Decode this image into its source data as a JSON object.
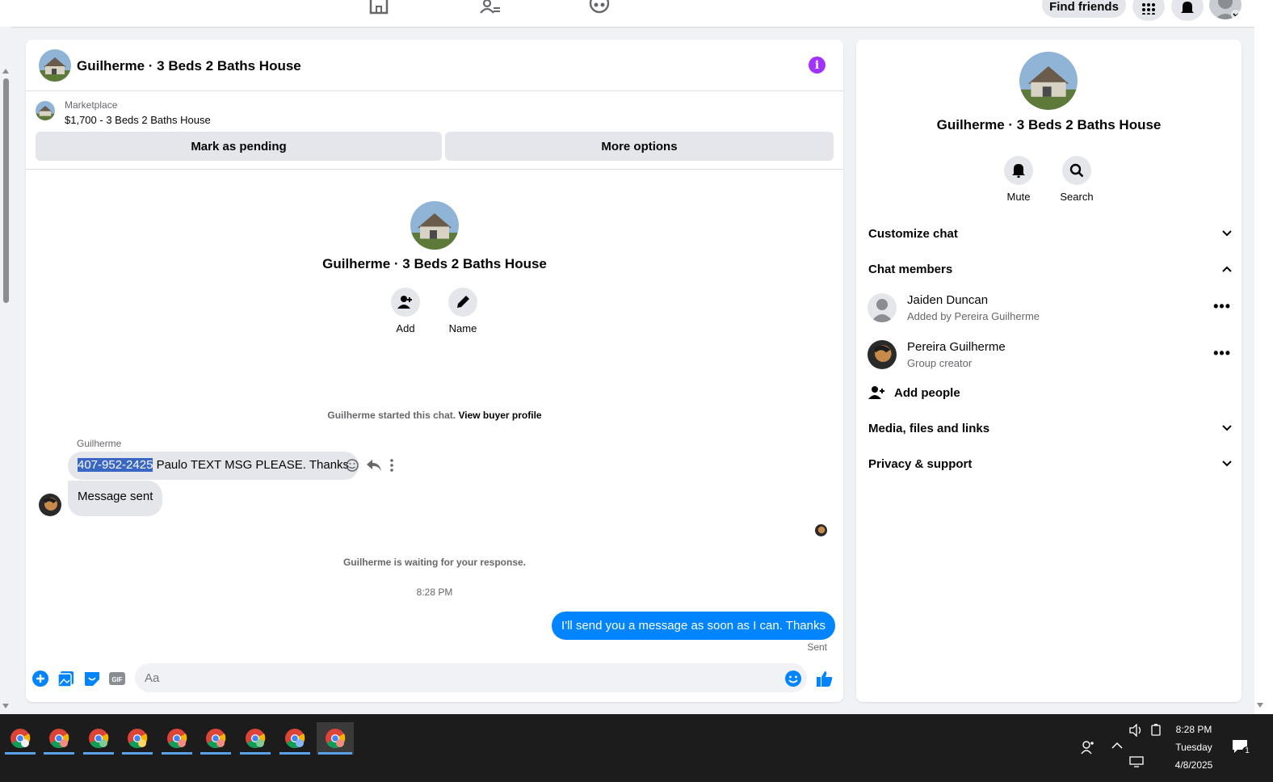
{
  "topbar": {
    "find_friends": "Find friends"
  },
  "chat": {
    "title": "Guilherme · 3 Beds 2 Baths House",
    "marketplace": {
      "label": "Marketplace",
      "listing": "$1,700 - 3 Beds 2 Baths House",
      "mark_pending": "Mark as pending",
      "more_options": "More options"
    },
    "intro": {
      "title": "Guilherme · 3 Beds 2 Baths House",
      "add_label": "Add",
      "name_label": "Name"
    },
    "started_text": "Guilherme started this chat.",
    "view_buyer_profile": "View buyer profile",
    "sender_name": "Guilherme",
    "msg1_selected": "407-952-2425",
    "msg1_rest": " Paulo TEXT MSG PLEASE. Thanks",
    "msg2": "Message sent",
    "waiting_text": "Guilherme is waiting for your response.",
    "timestamp": "8:28 PM",
    "outgoing": "I'll send you a message as soon as I can. Thanks",
    "sent_label": "Sent",
    "composer_placeholder": "Aa"
  },
  "side": {
    "title": "Guilherme · 3 Beds 2 Baths House",
    "mute": "Mute",
    "search": "Search",
    "customize_chat": "Customize chat",
    "chat_members": "Chat members",
    "members": [
      {
        "name": "Jaiden Duncan",
        "sub": "Added by Pereira Guilherme"
      },
      {
        "name": "Pereira Guilherme",
        "sub": "Group creator"
      }
    ],
    "add_people": "Add people",
    "media": "Media, files and links",
    "privacy": "Privacy & support"
  },
  "taskbar": {
    "time": "8:28 PM",
    "day": "Tuesday",
    "date": "4/8/2025",
    "notification_count": "1"
  },
  "colors": {
    "accent_blue": "#0084ff",
    "info_purple": "#a033ff",
    "selection": "#3a66c4"
  }
}
